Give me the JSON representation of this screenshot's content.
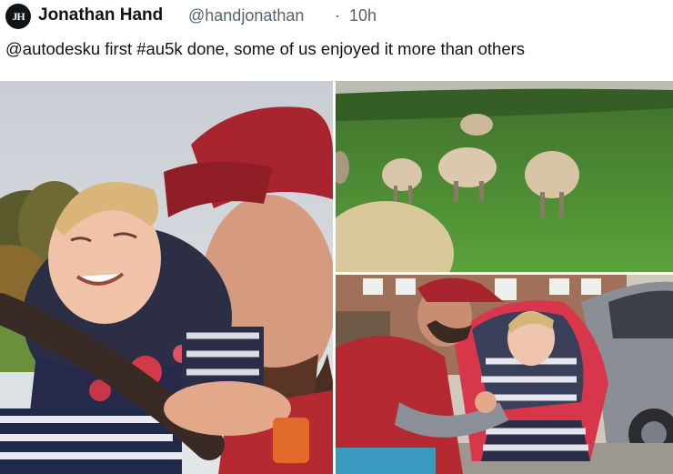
{
  "tweet": {
    "avatar_initials": "JH",
    "display_name": "Jonathan Hand",
    "handle": "@handjonathan",
    "separator": "·",
    "time": "10h",
    "text": "@autodesku first #au5k done, some of us enjoyed it more than others"
  },
  "colors": {
    "text_primary": "#0f1419",
    "text_secondary": "#536471",
    "cap_red": "#a8242e",
    "grass_green": "#4a8a32"
  }
}
